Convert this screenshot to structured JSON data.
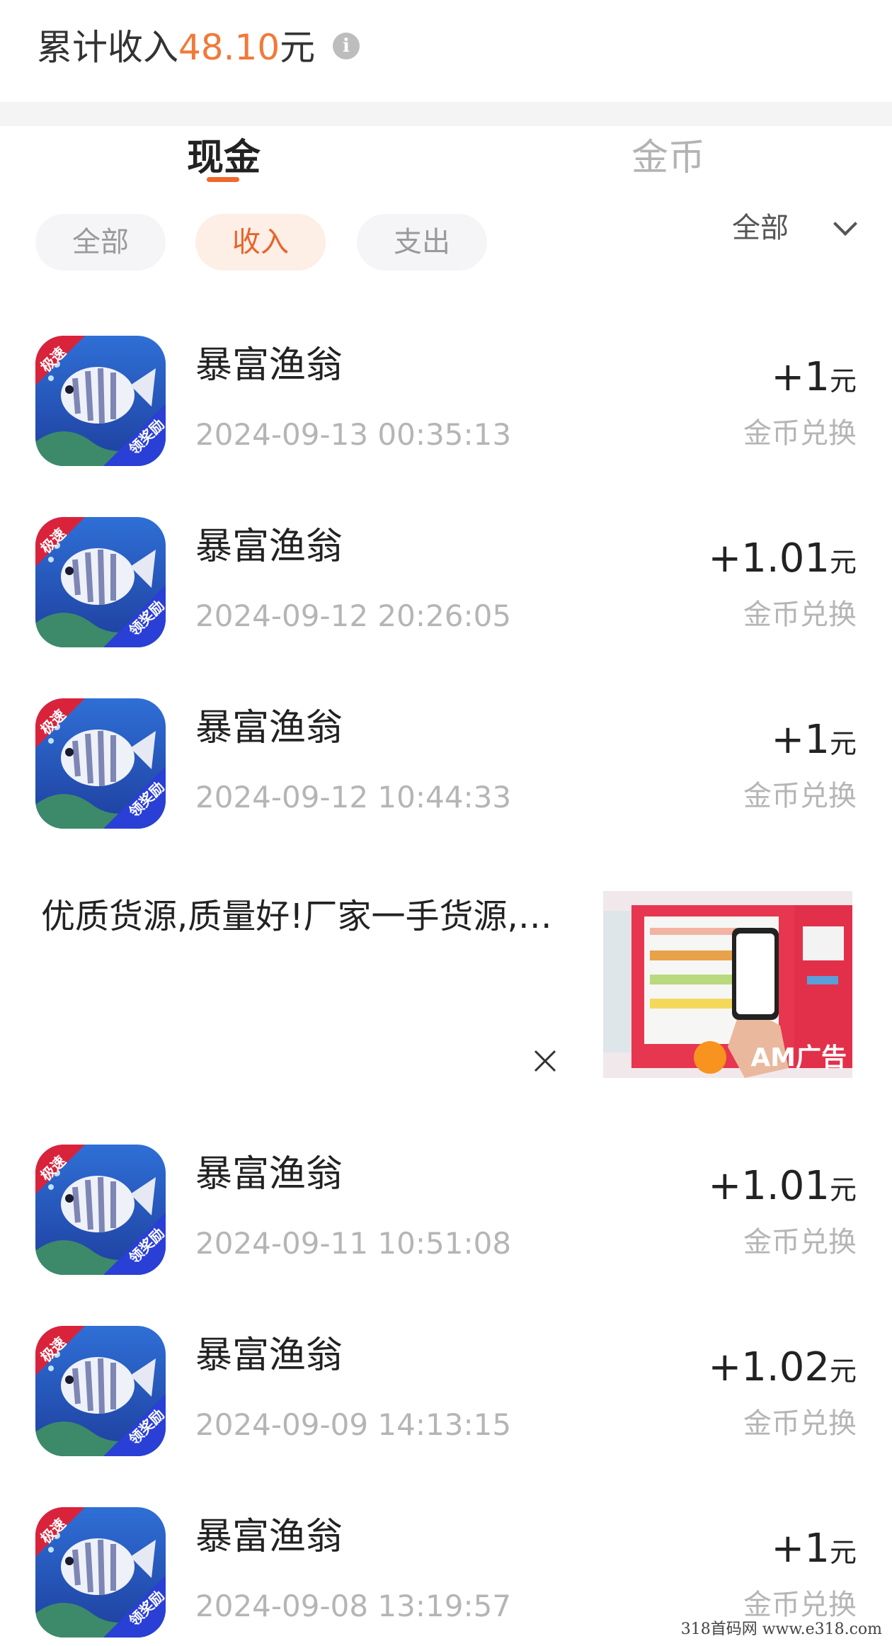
{
  "summary": {
    "prefix": "累计收入",
    "amount": "48.10",
    "unit": "元",
    "info_icon": "info-icon"
  },
  "tabs": [
    {
      "label": "现金",
      "active": true
    },
    {
      "label": "金币",
      "active": false
    }
  ],
  "filters": {
    "chips": [
      {
        "label": "全部",
        "active": false
      },
      {
        "label": "收入",
        "active": true
      },
      {
        "label": "支出",
        "active": false
      }
    ],
    "period": "全部",
    "chevron_icon": "chevron-down-icon"
  },
  "transactions": [
    {
      "app": "暴富渔翁",
      "time": "2024-09-13 00:35:13",
      "amount": "+1",
      "unit": "元",
      "type": "金币兑换"
    },
    {
      "app": "暴富渔翁",
      "time": "2024-09-12 20:26:05",
      "amount": "+1.01",
      "unit": "元",
      "type": "金币兑换"
    },
    {
      "app": "暴富渔翁",
      "time": "2024-09-12 10:44:33",
      "amount": "+1",
      "unit": "元",
      "type": "金币兑换"
    },
    {
      "app": "暴富渔翁",
      "time": "2024-09-11 10:51:08",
      "amount": "+1.01",
      "unit": "元",
      "type": "金币兑换"
    },
    {
      "app": "暴富渔翁",
      "time": "2024-09-09 14:13:15",
      "amount": "+1.02",
      "unit": "元",
      "type": "金币兑换"
    },
    {
      "app": "暴富渔翁",
      "time": "2024-09-08 13:19:57",
      "amount": "+1",
      "unit": "元",
      "type": "金币兑换"
    }
  ],
  "app_icon_badges": {
    "top": "极速",
    "bottom": "领奖励"
  },
  "ad": {
    "text": "优质货源,质量好!厂家一手货源,…",
    "label": "AM广告",
    "close_icon": "close-icon"
  },
  "watermark": "318首码网  www.e318.com",
  "colors": {
    "accent": "#f07a3a",
    "tab_underline": "#f0682b",
    "chip_active_bg": "#fdeee6",
    "muted_text": "#b5b5b5"
  }
}
